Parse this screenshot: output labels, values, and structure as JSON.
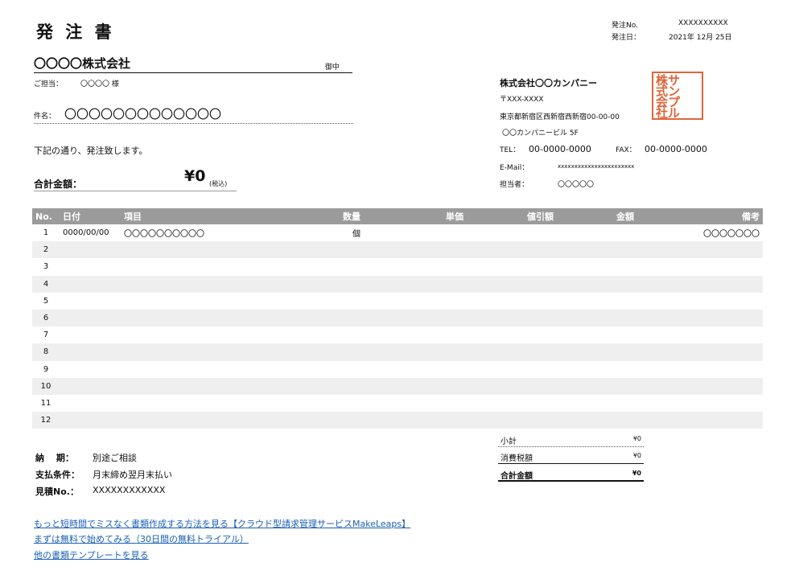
{
  "document": {
    "title": "発 注 書",
    "meta": {
      "number_label": "発注No.",
      "number_value": "XXXXXXXXXX",
      "date_label": "発注日：",
      "date_value": "2021年 12月 25日"
    }
  },
  "customer": {
    "name": "〇〇〇〇株式会社",
    "honorific": "御中",
    "contact_label": "ご担当：",
    "contact_value": "〇〇〇〇 様",
    "subject_label": "件名：",
    "subject_value": "〇〇〇〇〇〇〇〇〇〇〇〇〇",
    "intro": "下記の通り、発注致します。",
    "total_label": "合計金額：",
    "total_value": "¥0",
    "total_note": "(税込)"
  },
  "company": {
    "name": "株式会社〇〇カンパニー",
    "postal": "〒XXX-XXXX",
    "address1": "東京都新宿区西新宿西新宿00-00-00",
    "address2": "〇〇カンパニービル 5F",
    "tel_label": "TEL：",
    "tel_value": "00-0000-0000",
    "fax_label": "FAX：",
    "fax_value": "00-0000-0000",
    "email_label": "E-Mail：",
    "email_value": "xxxxxxxxxxxxxxxxxxxxxxx",
    "staff_label": "担当者：",
    "staff_value": "〇〇〇〇〇",
    "stamp_lines": [
      "株サ",
      "式ン",
      "会プ",
      "社ル"
    ],
    "stamp_color": "#e0643a"
  },
  "table": {
    "headers": {
      "no": "No.",
      "date": "日付",
      "item": "項目",
      "qty": "数量",
      "unit": "単価",
      "discount": "値引額",
      "amount": "金額",
      "note": "備考"
    },
    "rows": [
      {
        "no": "1",
        "date": "0000/00/00",
        "item": "〇〇〇〇〇〇〇〇〇〇",
        "qty": "個",
        "note": "〇〇〇〇〇〇〇"
      },
      {
        "no": "2"
      },
      {
        "no": "3"
      },
      {
        "no": "4"
      },
      {
        "no": "5"
      },
      {
        "no": "6"
      },
      {
        "no": "7"
      },
      {
        "no": "8"
      },
      {
        "no": "9"
      },
      {
        "no": "10"
      },
      {
        "no": "11"
      },
      {
        "no": "12"
      }
    ],
    "header_color": "#9b9b9b",
    "stripe_color": "#efefef"
  },
  "summary": {
    "subtotal_label": "小計",
    "subtotal_value": "¥0",
    "tax_label": "消費税額",
    "tax_value": "¥0",
    "total_label": "合計金額",
    "total_value": "¥0"
  },
  "terms": {
    "delivery_label": "納　 期：",
    "delivery_value": "別途ご相談",
    "payment_label": "支払条件：",
    "payment_value": "月末締め翌月末払い",
    "quote_label": "見積No.：",
    "quote_value": "XXXXXXXXXXXX"
  },
  "links": {
    "link1": "もっと短時間でミスなく書類作成する方法を見る【クラウド型請求管理サービスMakeLeaps】",
    "link2": "まずは無料で始めてみる（30日間の無料トライアル）",
    "link3": "他の書類テンプレートを見る",
    "color": "#1a5fb4"
  }
}
